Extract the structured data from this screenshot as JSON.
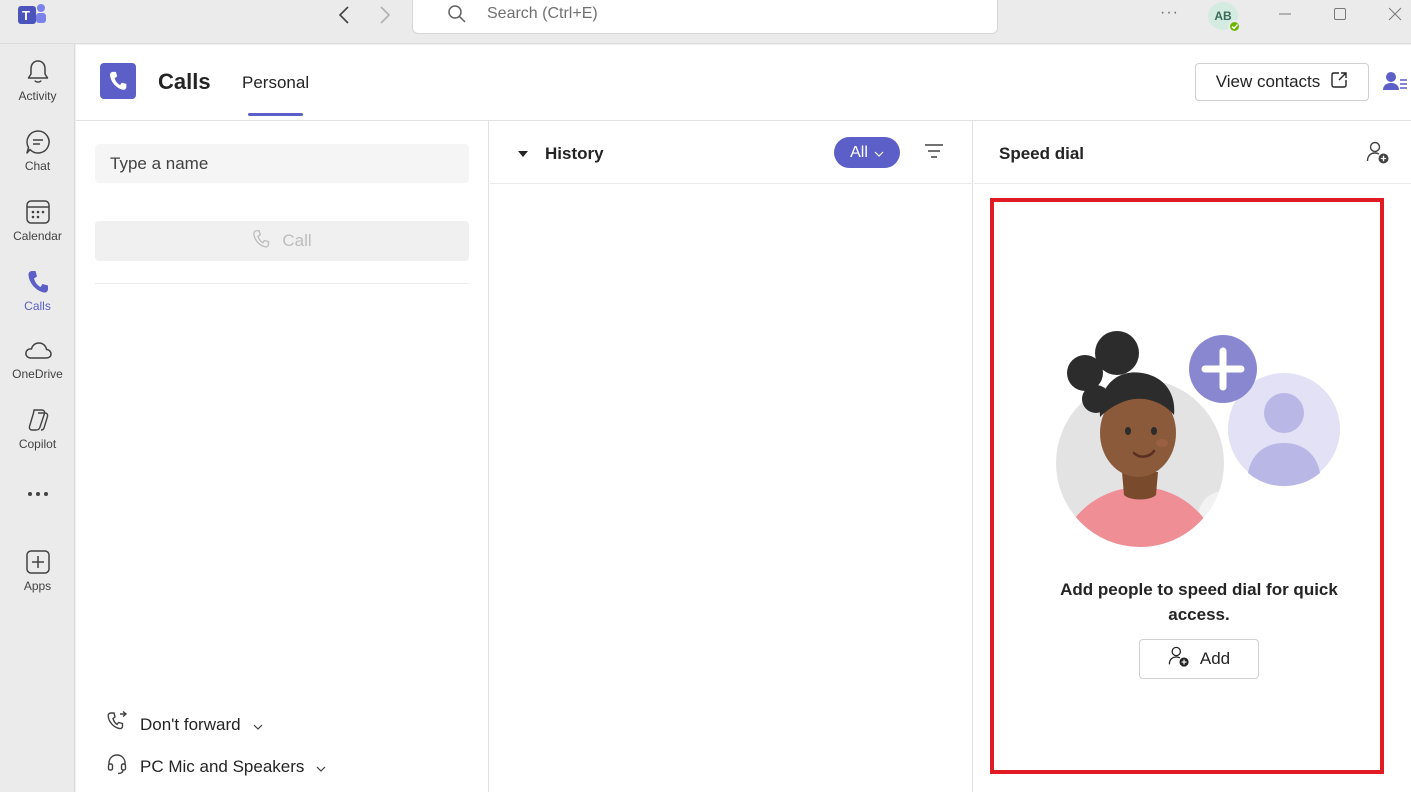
{
  "titlebar": {
    "app_logo_icon": "teams-logo-icon",
    "search_placeholder": "Search (Ctrl+E)",
    "more_label": "···",
    "avatar_initials": "AB",
    "presence_status": "available"
  },
  "rail": {
    "items": [
      {
        "label": "Activity",
        "icon": "bell-icon",
        "active": false
      },
      {
        "label": "Chat",
        "icon": "chat-icon",
        "active": false
      },
      {
        "label": "Calendar",
        "icon": "calendar-icon",
        "active": false
      },
      {
        "label": "Calls",
        "icon": "phone-icon",
        "active": true
      },
      {
        "label": "OneDrive",
        "icon": "cloud-icon",
        "active": false
      },
      {
        "label": "Copilot",
        "icon": "copilot-icon",
        "active": false
      },
      {
        "label": "",
        "icon": "more-icon",
        "active": false
      },
      {
        "label": "Apps",
        "icon": "add-app-icon",
        "active": false
      }
    ]
  },
  "header": {
    "title": "Calls",
    "tab": "Personal",
    "view_contacts_label": "View contacts"
  },
  "left_pane": {
    "name_placeholder": "Type a name",
    "call_label": "Call",
    "forward_label": "Don't forward",
    "device_label": "PC Mic and Speakers"
  },
  "history": {
    "title": "History",
    "filter_label": "All"
  },
  "speed_dial": {
    "title": "Speed dial",
    "message": "Add people to speed dial for quick access.",
    "add_label": "Add"
  },
  "colors": {
    "accent": "#5b5fc7",
    "highlight_border": "#e01b24",
    "presence_green": "#6bb700"
  }
}
